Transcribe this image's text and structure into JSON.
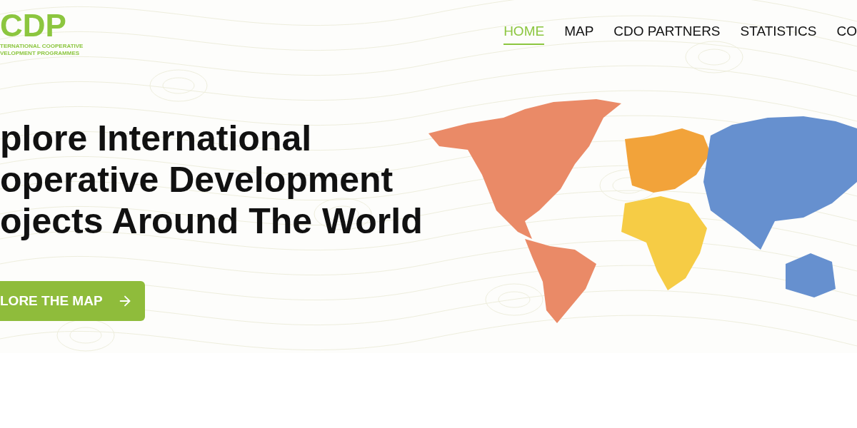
{
  "logo": {
    "letters": "CDP",
    "line_1": "TERNATIONAL COOPERATIVE",
    "line_2": "VELOPMENT PROGRAMMES"
  },
  "nav": [
    {
      "label": "HOME",
      "selected": true
    },
    {
      "label": "MAP",
      "selected": false
    },
    {
      "label": "CDO PARTNERS",
      "selected": false
    },
    {
      "label": "STATISTICS",
      "selected": false
    },
    {
      "label": "CO",
      "selected": false
    }
  ],
  "hero": {
    "heading_lines": [
      "plore International",
      "operative Development",
      "ojects Around The World"
    ],
    "button": "LORE THE MAP"
  }
}
